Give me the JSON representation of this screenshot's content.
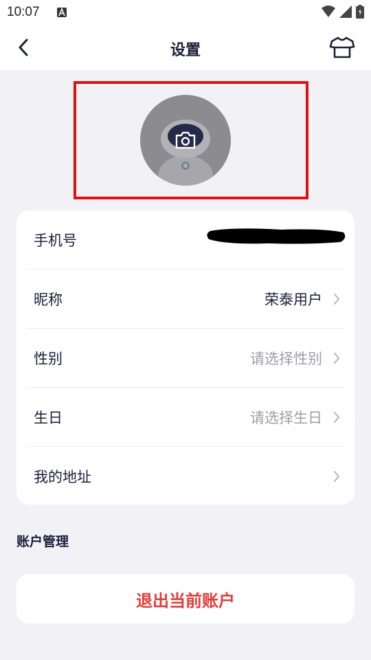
{
  "status_bar": {
    "time": "10:07",
    "icons": [
      "notification-a-icon",
      "wifi-icon",
      "signal-icon",
      "battery-icon"
    ]
  },
  "nav": {
    "title": "设置",
    "back_icon": "chevron-left-icon",
    "right_icon": "shirt-icon"
  },
  "avatar": {
    "overlay_icon": "camera-icon"
  },
  "profile_rows": [
    {
      "label": "手机号",
      "value": "",
      "redacted": true
    },
    {
      "label": "昵称",
      "value": "荣泰用户",
      "placeholder": false
    },
    {
      "label": "性别",
      "value": "请选择性别",
      "placeholder": true
    },
    {
      "label": "生日",
      "value": "请选择生日",
      "placeholder": true
    },
    {
      "label": "我的地址",
      "value": "",
      "placeholder": false
    }
  ],
  "account_section": {
    "title": "账户管理",
    "logout_label": "退出当前账户"
  },
  "colors": {
    "background": "#f2f2f6",
    "card": "#ffffff",
    "text_primary": "#1c1f3a",
    "text_placeholder": "#9c9daa",
    "danger": "#e33b3b",
    "highlight_box": "#e20f0f"
  }
}
